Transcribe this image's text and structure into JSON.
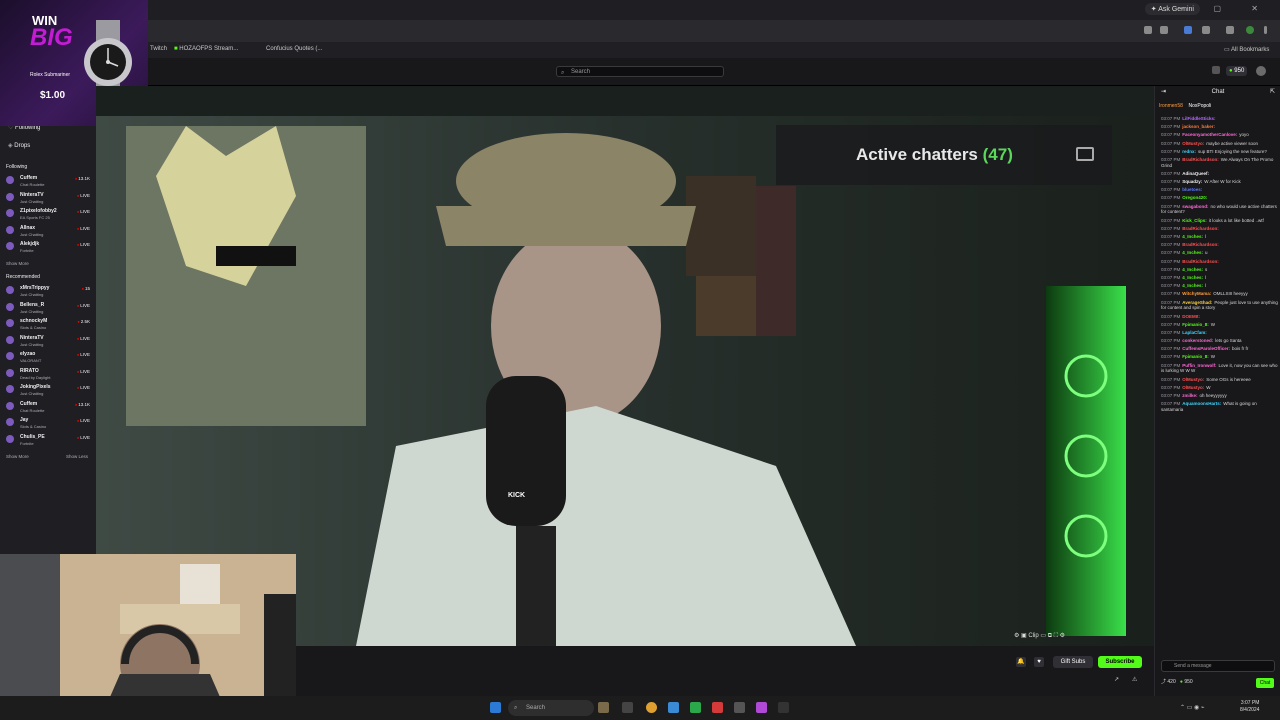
{
  "browser": {
    "gemini_label": "Ask Gemini",
    "bookmarks": [
      "Twitch",
      "HOZAOFPS Stream...",
      "Confucius Quotes (..."
    ],
    "all_bookmarks": "All Bookmarks"
  },
  "ad": {
    "line1": "WIN",
    "line2": "BIG",
    "product": "Rolex Submariner",
    "price": "$1.00"
  },
  "topnav": {
    "search_placeholder": "Search",
    "points": "950"
  },
  "sidebar": {
    "following_label": "Following",
    "drops_label": "Drops",
    "following_header": "Following",
    "following": [
      {
        "name": "Cuffem",
        "sub": "Chat Roulette",
        "count": "13.1K"
      },
      {
        "name": "NinteraTV",
        "sub": "Just Chatting",
        "count": "LIVE"
      },
      {
        "name": "Z1pixelofobby2",
        "sub": "EA Sports FC 25",
        "count": "LIVE"
      },
      {
        "name": "Allnax",
        "sub": "Just Chatting",
        "count": "LIVE"
      },
      {
        "name": "Alekjdjk",
        "sub": "Fortnite",
        "count": "LIVE"
      }
    ],
    "show_more": "Show More",
    "recommended_header": "Recommended",
    "recommended": [
      {
        "name": "xMrsTrippyy",
        "sub": "Just Chatting",
        "count": "15"
      },
      {
        "name": "Bellens_R",
        "sub": "Just Chatting",
        "count": "LIVE"
      },
      {
        "name": "schnockyM",
        "sub": "Slots & Casino",
        "count": "2.5K"
      },
      {
        "name": "NinteraTV",
        "sub": "Just Chatting",
        "count": "LIVE"
      },
      {
        "name": "elyzao",
        "sub": "VALORANT",
        "count": "LIVE"
      },
      {
        "name": "RIRATO",
        "sub": "Dead by Daylight",
        "count": "LIVE"
      },
      {
        "name": "JokingPixels",
        "sub": "Just Chatting",
        "count": "LIVE"
      },
      {
        "name": "Cuffem",
        "sub": "Chat Roulette",
        "count": "13.1K"
      },
      {
        "name": "Jay",
        "sub": "Slots & Casino",
        "count": "LIVE"
      },
      {
        "name": "Chulis_PE",
        "sub": "Fortnite",
        "count": "LIVE"
      }
    ],
    "show_more2": "Show More",
    "show_less": "Show Less"
  },
  "video": {
    "overlay_label": "Active chatters",
    "overlay_count": "(47)",
    "mic_brand": "KICK",
    "clip_label": "Clip"
  },
  "actions": {
    "gift_subs": "Gift Subs",
    "subscribe": "Subscribe"
  },
  "chat": {
    "title": "Chat",
    "top_users": [
      "Ironmen58",
      "NoxPopoli"
    ],
    "messages": [
      {
        "time": "03:07 PM",
        "user": "LilFiddleSticks:",
        "text": "",
        "color": "#b86bff"
      },
      {
        "time": "03:07 PM",
        "user": "jackson_baker:",
        "text": "",
        "color": "#ff7b3a"
      },
      {
        "time": "03:07 PM",
        "user": "FaceonyamotherCanlove:",
        "text": "yoyo",
        "color": "#ff6ad5"
      },
      {
        "time": "03:07 PM",
        "user": "OlMustyo:",
        "text": "maybe active viewer soon",
        "color": "#ff4f4f"
      },
      {
        "time": "03:07 PM",
        "user": "rednx:",
        "text": "sup BTI Enjoying the new feature?",
        "color": "#3dd6ff"
      },
      {
        "time": "03:07 PM",
        "user": "BradRichardson:",
        "text": "We Always On The Promo Grind",
        "color": "#ff4f4f"
      },
      {
        "time": "03:07 PM",
        "user": "AdinaQueef:",
        "text": "",
        "color": "#efeff1"
      },
      {
        "time": "03:07 PM",
        "user": "Squadzy:",
        "text": "W After W for Kick",
        "color": "#efeff1"
      },
      {
        "time": "03:07 PM",
        "user": "bluetoes:",
        "text": "",
        "color": "#5b7bff"
      },
      {
        "time": "03:07 PM",
        "user": "Oregon420:",
        "text": "",
        "color": "#53fc18"
      },
      {
        "time": "03:07 PM",
        "user": "swagabond:",
        "text": "no who would use active chatters for content?",
        "color": "#ff6ad5"
      },
      {
        "time": "03:07 PM",
        "user": "Kick_Clips:",
        "text": "it looks a lot like botted ..wtf",
        "color": "#53fc18"
      },
      {
        "time": "03:07 PM",
        "user": "BradRichardson:",
        "text": "",
        "color": "#ff4f4f"
      },
      {
        "time": "03:07 PM",
        "user": "4_Inches:",
        "text": "l",
        "color": "#53fc18"
      },
      {
        "time": "03:07 PM",
        "user": "BradRichardson:",
        "text": "",
        "color": "#ff4f4f"
      },
      {
        "time": "03:07 PM",
        "user": "4_Inches:",
        "text": "u",
        "color": "#53fc18"
      },
      {
        "time": "03:07 PM",
        "user": "BradRichardson:",
        "text": "",
        "color": "#ff4f4f"
      },
      {
        "time": "03:07 PM",
        "user": "4_Inches:",
        "text": "s",
        "color": "#53fc18"
      },
      {
        "time": "03:07 PM",
        "user": "4_Inches:",
        "text": "l",
        "color": "#53fc18"
      },
      {
        "time": "03:07 PM",
        "user": "4_Inches:",
        "text": "l",
        "color": "#53fc18"
      },
      {
        "time": "03:07 PM",
        "user": "WitchyMama:",
        "text": "OMLLSIII heeyyy",
        "color": "#ff9d3a"
      },
      {
        "time": "03:07 PM",
        "user": "AverageShad:",
        "text": "People just love to use anything for content and spin a story",
        "color": "#ffd23a"
      },
      {
        "time": "03:07 PM",
        "user": "DOEMIt:",
        "text": "",
        "color": "#ff4f4f"
      },
      {
        "time": "03:07 PM",
        "user": "Fpimanio_8:",
        "text": "W",
        "color": "#53fc18"
      },
      {
        "time": "03:07 PM",
        "user": "LaplaCfam:",
        "text": "",
        "color": "#3dd6ff"
      },
      {
        "time": "03:07 PM",
        "user": "conkerstoned:",
        "text": "lets go Santa",
        "color": "#ff6ad5"
      },
      {
        "time": "03:07 PM",
        "user": "CuffemsParoleOfficer:",
        "text": "bois fr fr",
        "color": "#ff6ad5"
      },
      {
        "time": "03:07 PM",
        "user": "Fpimanio_8:",
        "text": "W",
        "color": "#53fc18"
      },
      {
        "time": "03:07 PM",
        "user": "Puffin_Ironwolf:",
        "text": "Love it, now you can see who is lurking W W W",
        "color": "#ff6ad5"
      },
      {
        "time": "03:07 PM",
        "user": "OlMustyo:",
        "text": "Some OGs is hereeee",
        "color": "#ff4f4f"
      },
      {
        "time": "03:07 PM",
        "user": "OlMustyo:",
        "text": "W",
        "color": "#ff4f4f"
      },
      {
        "time": "03:07 PM",
        "user": "zmilke:",
        "text": "oh heeyyyyyy",
        "color": "#ff6ad5"
      },
      {
        "time": "03:07 PM",
        "user": "AquamoonsHarts:",
        "text": "What is going on santamaria",
        "color": "#3dd6ff"
      }
    ],
    "input_placeholder": "Send a message",
    "bottom_count": "420",
    "bottom_points": "950",
    "send_label": "Chat"
  },
  "taskbar": {
    "search_placeholder": "Search",
    "time": "3:07 PM",
    "date": "8/4/2024"
  }
}
